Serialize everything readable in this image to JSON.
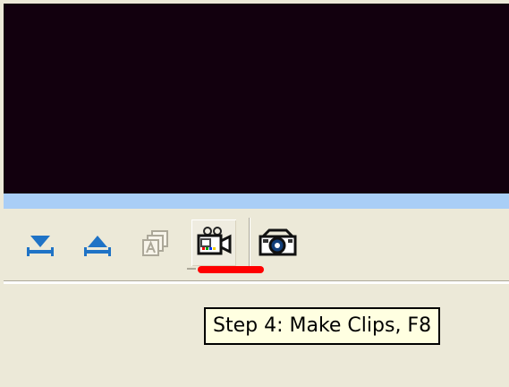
{
  "toolbar": {
    "buttons": [
      {
        "name": "move-down",
        "icon": "blue-down-arrow-icon",
        "state": "enabled"
      },
      {
        "name": "move-up",
        "icon": "blue-up-arrow-icon",
        "state": "enabled"
      },
      {
        "name": "overlay-text",
        "icon": "stacked-windows-a-icon",
        "state": "disabled"
      },
      {
        "name": "make-clips",
        "icon": "film-camera-icon",
        "state": "active"
      },
      {
        "name": "snapshot",
        "icon": "photo-camera-icon",
        "state": "enabled"
      }
    ]
  },
  "tooltip": {
    "text": "Step 4: Make Clips, F8"
  },
  "colors": {
    "preview_background": "#12000e",
    "timeline_strip": "#a9cef6",
    "window_background": "#ece9d8",
    "highlight_marker": "#ff0000",
    "tooltip_background": "#ffffe1"
  }
}
